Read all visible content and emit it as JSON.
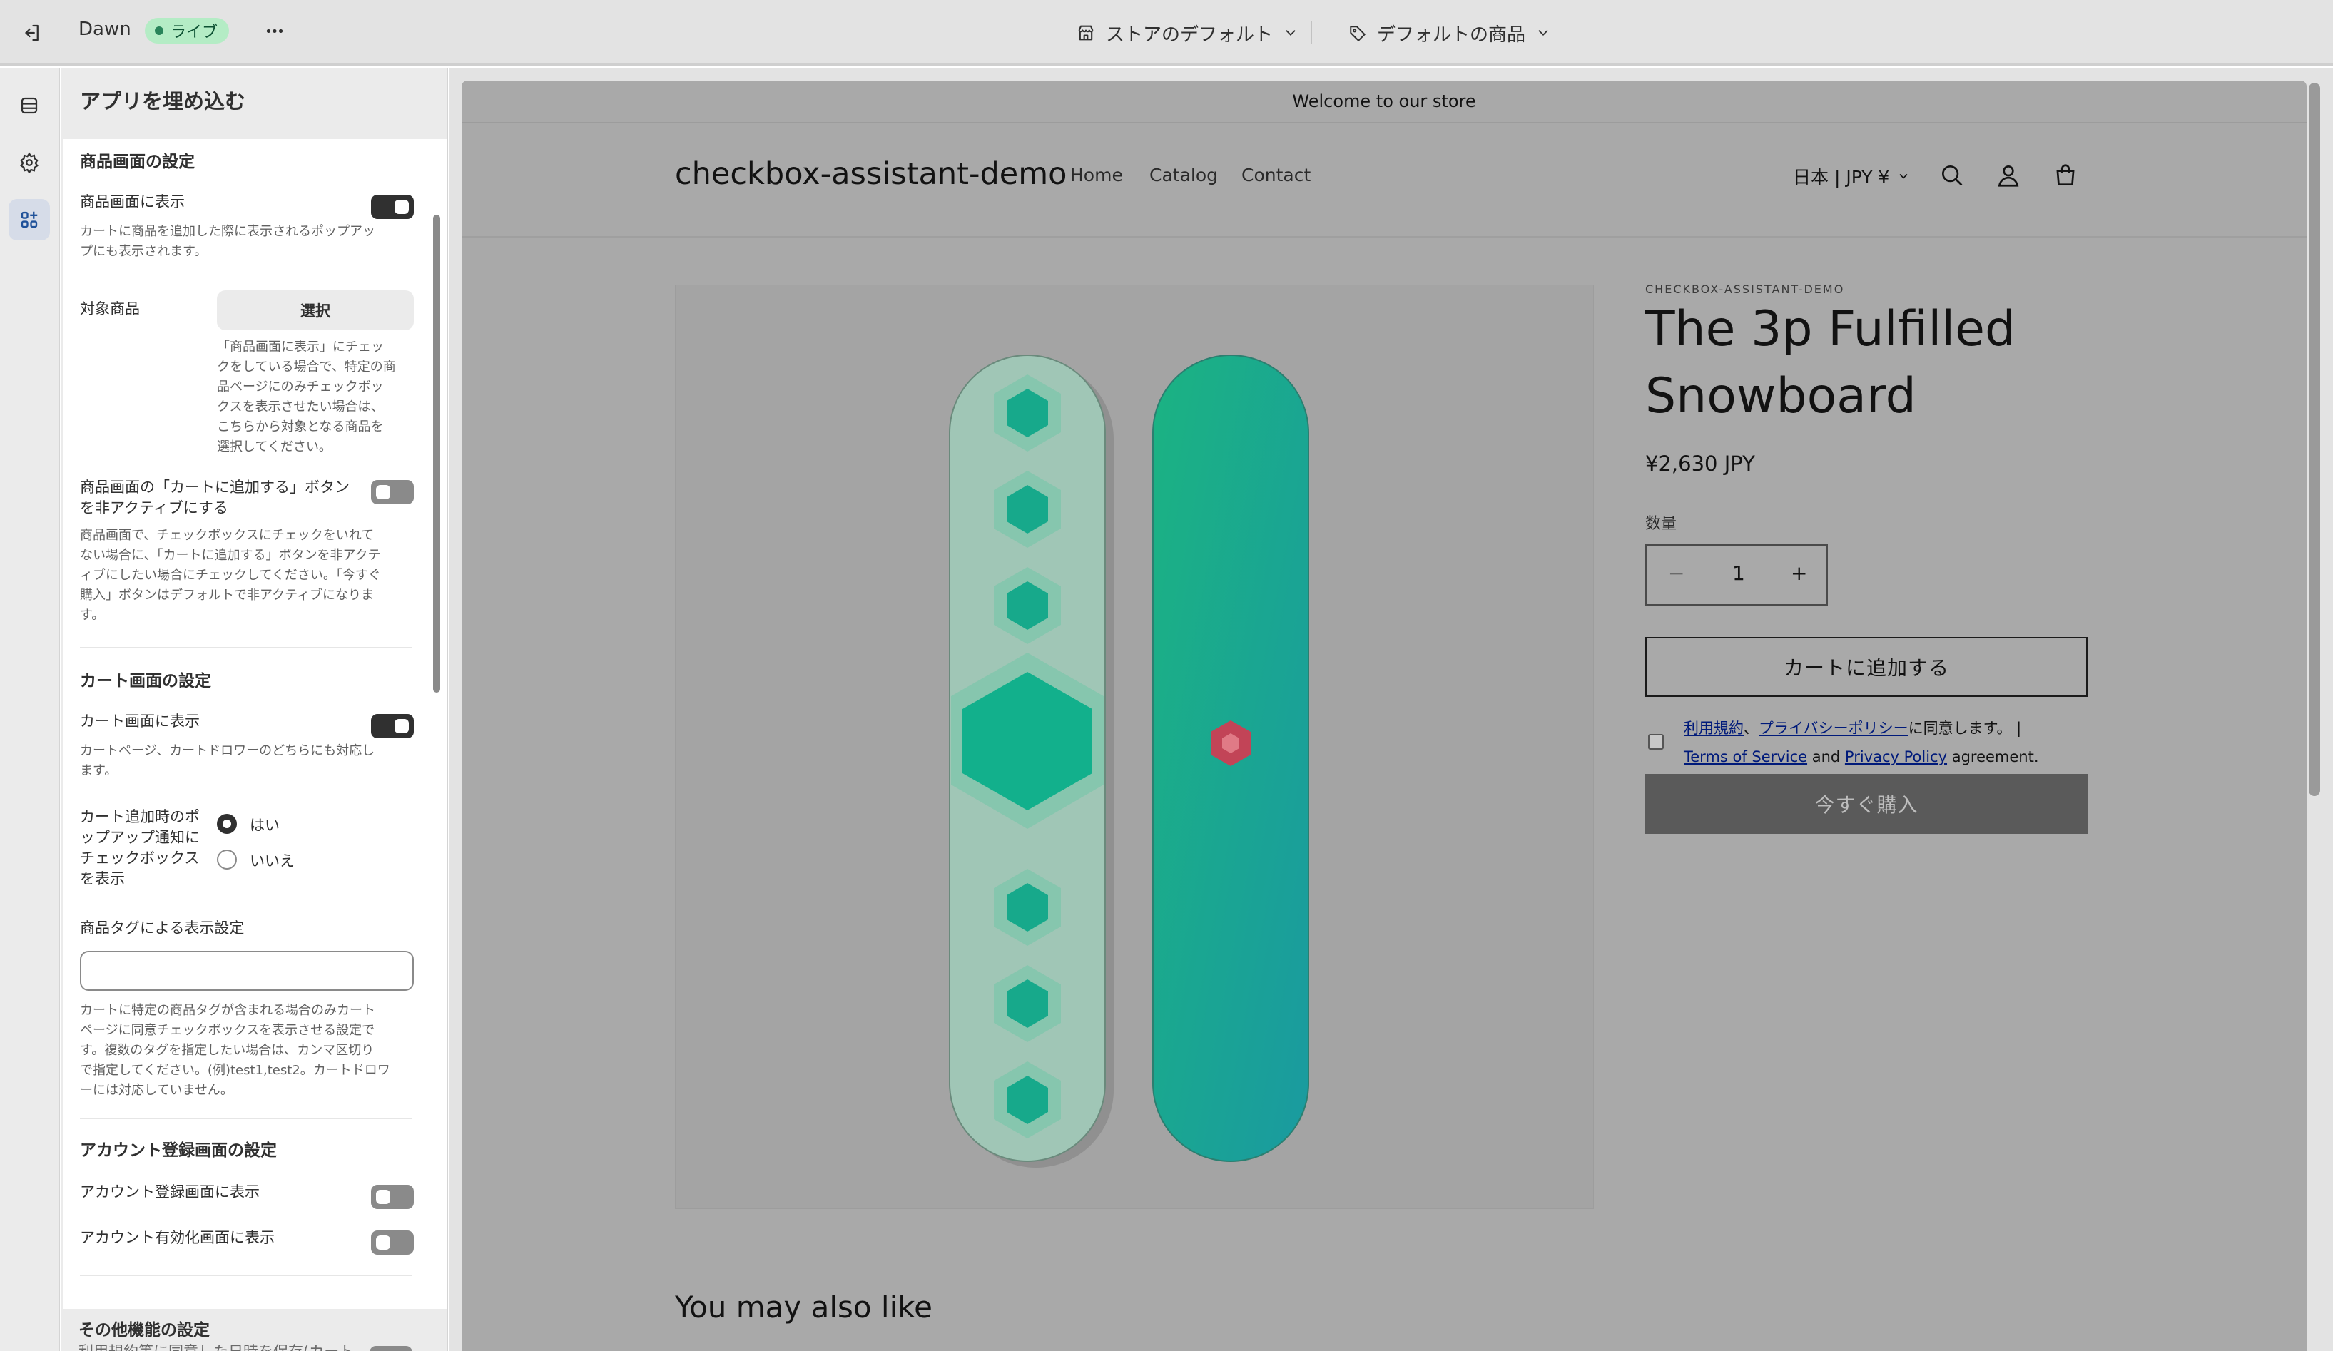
{
  "topbar": {
    "theme_name": "Dawn",
    "live_label": "ライブ",
    "more_label": "•••",
    "store_select": "ストアのデフォルト",
    "product_select": "デフォルトの商品"
  },
  "panel": {
    "title": "アプリを埋め込む",
    "product_section": {
      "title": "商品画面の設定",
      "show_label": "商品画面に表示",
      "show_on": true,
      "show_help": [
        "カートに商品を追加した際に表示されるポップアッ",
        "プにも表示されます。"
      ],
      "target_label": "対象商品",
      "select_button": "選択",
      "target_help": [
        "「商品画面に表示」にチェッ",
        "クをしている場合で、特定の商",
        "品ページにのみチェックボッ",
        "クスを表示させたい場合は、",
        "こちらから対象となる商品を",
        "選択してください。"
      ],
      "disable_cart_label": [
        "商品画面の「カートに追加する」ボタン",
        "を非アクティブにする"
      ],
      "disable_cart_on": false,
      "disable_cart_help": [
        "商品画面で、チェックボックスにチェックをいれて",
        "ない場合に、「カートに追加する」ボタンを非アクテ",
        "ィブにしたい場合にチェックしてください。「今すぐ",
        "購入」ボタンはデフォルトで非アクティブになりま",
        "す。"
      ]
    },
    "cart_section": {
      "title": "カート画面の設定",
      "show_label": "カート画面に表示",
      "show_on": true,
      "show_help": [
        "カートページ、カートドロワーのどちらにも対応し",
        "ます。"
      ],
      "popup_label": [
        "カート追加時のポ",
        "ップアップ通知に",
        "チェックボックス",
        "を表示"
      ],
      "popup_yes": "はい",
      "popup_no": "いいえ",
      "tag_label": "商品タグによる表示設定",
      "tag_value": "",
      "tag_help": [
        "カートに特定の商品タグが含まれる場合のみカート",
        "ページに同意チェックボックスを表示させる設定で",
        "す。複数のタグを指定したい場合は、カンマ区切り",
        "で指定してください。(例)test1,test2。カートドロワ",
        "ーには対応していません。"
      ]
    },
    "account_section": {
      "title": "アカウント登録画面の設定",
      "register_label": "アカウント登録画面に表示",
      "activate_label": "アカウント有効化画面に表示"
    },
    "other_section": {
      "title": "その他機能の設定",
      "save_label": "利用規約等に同意した日時を保存(カート"
    }
  },
  "store": {
    "announcement": "Welcome to our store",
    "name": "checkbox-assistant-demo",
    "nav": [
      "Home",
      "Catalog",
      "Contact"
    ],
    "locale": "日本 | JPY ¥",
    "vendor": "CHECKBOX-ASSISTANT-DEMO",
    "product_title": [
      "The 3p Fulfilled",
      "Snowboard"
    ],
    "price": "¥2,630 JPY",
    "qty_label": "数量",
    "qty_minus": "−",
    "qty_value": "1",
    "qty_plus": "+",
    "add_to_cart": "カートに追加する",
    "agree": {
      "terms_jp": "利用規約",
      "sep_jp": "、",
      "privacy_jp": "プライバシーポリシー",
      "suffix_jp": "に同意します。 |",
      "terms_en": "Terms of Service",
      "and_en": " and ",
      "privacy_en": "Privacy Policy",
      "suffix_en": " agreement."
    },
    "buy_now": "今すぐ購入",
    "also_like": "You may also like"
  },
  "colors": {
    "accent_green": "#29845a",
    "board_teal": "#1fa57f",
    "board_mint": "#9fc8b7"
  }
}
